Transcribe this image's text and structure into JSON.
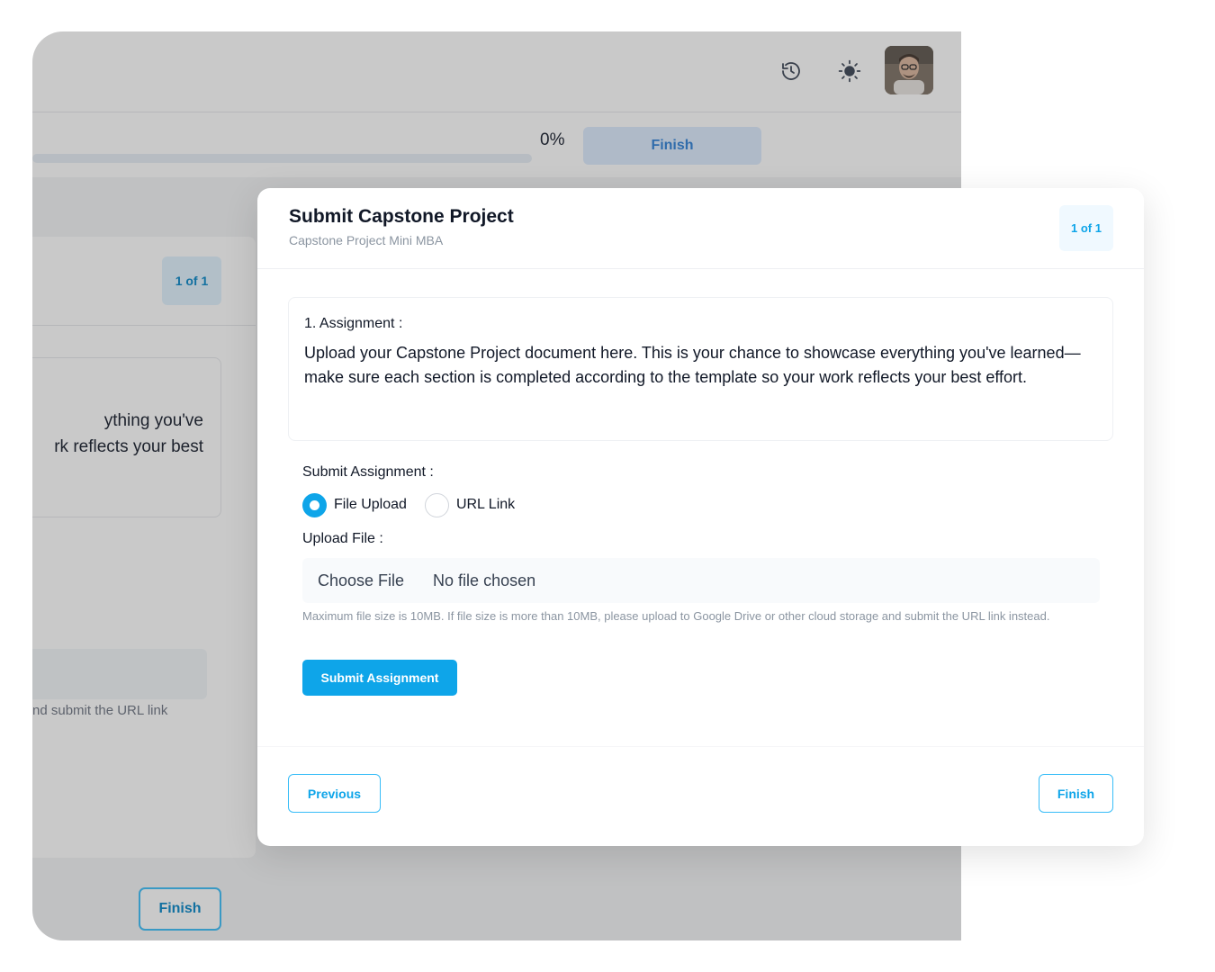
{
  "background": {
    "progress_percent": "0%",
    "progress_value": 0,
    "finish_top_label": "Finish",
    "left_badge": "1 of 1",
    "left_text_line1": "ything you've",
    "left_text_line2": "rk reflects your best",
    "left_note": "nd submit the URL link",
    "left_finish_label": "Finish",
    "icons": [
      "history-icon",
      "sun-icon",
      "avatar"
    ]
  },
  "modal": {
    "title": "Submit Capstone Project",
    "subtitle": "Capstone Project Mini MBA",
    "page_badge": "1 of 1",
    "assignment_label": "1. Assignment :",
    "assignment_text": "Upload your Capstone Project document here. This is your chance to showcase everything you've learned—make sure each section is completed according to the template so your work reflects your best effort.",
    "submit_label": "Submit Assignment :",
    "options": [
      {
        "label": "File Upload",
        "selected": true
      },
      {
        "label": "URL Link",
        "selected": false
      }
    ],
    "upload_label": "Upload File :",
    "choose_file": "Choose File",
    "no_file": "No file chosen",
    "file_note": "Maximum file size is 10MB. If file size is more than 10MB, please upload to Google Drive or other cloud storage and submit the URL link instead.",
    "submit_button": "Submit Assignment",
    "previous_button": "Previous",
    "finish_button": "Finish"
  },
  "colors": {
    "accent": "#0ea5e9",
    "accent_light": "#f0f9ff",
    "muted_text": "#8b95a1"
  }
}
